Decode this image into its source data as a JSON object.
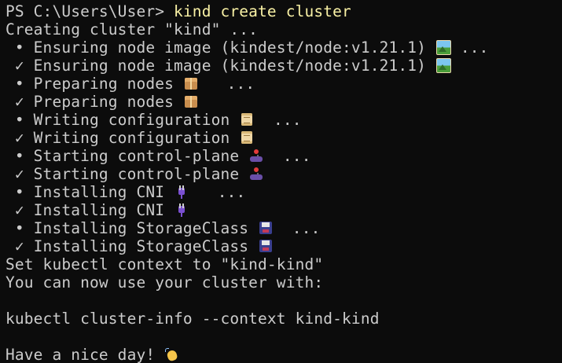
{
  "terminal": {
    "prompt": "PS C:\\Users\\User> ",
    "command": "kind create cluster",
    "lines": [
      {
        "text": "Creating cluster \"kind\" ..."
      },
      {
        "pre": " • Ensuring node image (kindest/node:v1.21.1) ",
        "icon": "frame-picture-icon",
        "post": " ..."
      },
      {
        "pre": " ✓ Ensuring node image (kindest/node:v1.21.1) ",
        "icon": "frame-picture-icon",
        "post": ""
      },
      {
        "pre": " • Preparing nodes ",
        "icon": "package-icon",
        "post": "   ..."
      },
      {
        "pre": " ✓ Preparing nodes ",
        "icon": "package-icon",
        "post": ""
      },
      {
        "pre": " • Writing configuration ",
        "icon": "scroll-icon",
        "post": "  ..."
      },
      {
        "pre": " ✓ Writing configuration ",
        "icon": "scroll-icon",
        "post": ""
      },
      {
        "pre": " • Starting control-plane ",
        "icon": "joystick-icon",
        "post": "  ..."
      },
      {
        "pre": " ✓ Starting control-plane ",
        "icon": "joystick-icon",
        "post": ""
      },
      {
        "pre": " • Installing CNI ",
        "icon": "plug-icon",
        "post": "   ..."
      },
      {
        "pre": " ✓ Installing CNI ",
        "icon": "plug-icon",
        "post": ""
      },
      {
        "pre": " • Installing StorageClass ",
        "icon": "floppy-disk-icon",
        "post": "  ..."
      },
      {
        "pre": " ✓ Installing StorageClass ",
        "icon": "floppy-disk-icon",
        "post": ""
      },
      {
        "text": "Set kubectl context to \"kind-kind\""
      },
      {
        "text": "You can now use your cluster with:"
      },
      {
        "text": ""
      },
      {
        "text": "kubectl cluster-info --context kind-kind"
      },
      {
        "text": ""
      },
      {
        "pre": "Have a nice day! ",
        "icon": "waving-hand-icon",
        "post": ""
      }
    ]
  },
  "colors": {
    "background": "#0c0c0c",
    "foreground": "#cccccc",
    "command": "#f9f1a5"
  }
}
